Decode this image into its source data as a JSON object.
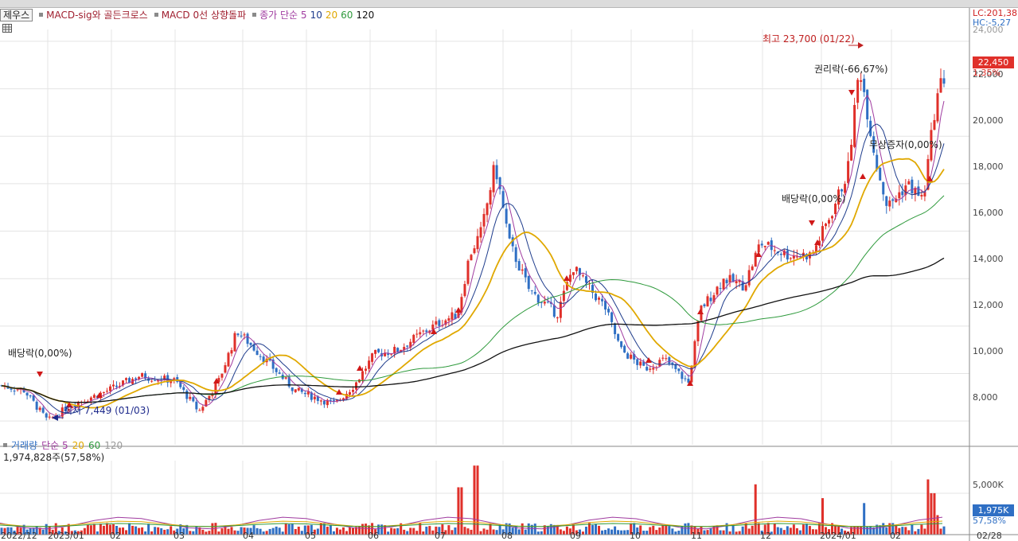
{
  "indicator_legend": {
    "tab_label": "제우스",
    "items": [
      {
        "text": "MACD-sig와 골든크로스"
      },
      {
        "text": "MACD 0선 상향돌파"
      }
    ],
    "ma_prefix": "종가 단순 5",
    "ma_periods": [
      "10",
      "20",
      "60",
      "120"
    ]
  },
  "volume_legend": {
    "title": "거래량",
    "ma_prefix": "단순 5",
    "ma_periods": [
      "20",
      "60",
      "120"
    ],
    "current_volume": "1,974,828주(57,58%)"
  },
  "right_axis": {
    "lc": "LC:201,38",
    "hc": "HC:-5,27",
    "top_cut": "24,000",
    "price_ticks": [
      "22,000",
      "20,000",
      "18,000",
      "16,000",
      "14,000",
      "12,000",
      "10,000",
      "8,000"
    ],
    "current_price": "22,450",
    "current_change": "1,35%",
    "volume_tick": "5,000K",
    "current_volume_tag": "1,975K",
    "current_volume_pct": "57,58%"
  },
  "annotations": {
    "high": "최고 23,700 (01/22)",
    "low": "최저 7,449 (01/03)",
    "dividend_left": "배당락(0,00%)",
    "dividend_right": "배당락(0,00%)",
    "rights_ex": "권리락(-66,67%)",
    "bonus_issue": "무상증자(0,00%)"
  },
  "x_axis": [
    "2022/12",
    "2023/01",
    "02",
    "03",
    "04",
    "05",
    "06",
    "07",
    "08",
    "09",
    "10",
    "11",
    "12",
    "2024/01",
    "02",
    "02/28"
  ],
  "colors": {
    "up": "#e0302a",
    "down": "#2f6fc4",
    "ma5": "#a03ca0",
    "ma10": "#1e3c8c",
    "ma20": "#e0a800",
    "ma60": "#2e9a3c",
    "ma120": "#111111"
  },
  "chart_data": {
    "type": "candlestick",
    "price_range": [
      7000,
      24500
    ],
    "anchors": [
      [
        0,
        9500
      ],
      [
        30,
        9300
      ],
      [
        60,
        8000
      ],
      [
        90,
        8700
      ],
      [
        130,
        9200
      ],
      [
        175,
        9900
      ],
      [
        220,
        9700
      ],
      [
        250,
        8400
      ],
      [
        275,
        9700
      ],
      [
        298,
        11800
      ],
      [
        330,
        10700
      ],
      [
        370,
        9300
      ],
      [
        420,
        8700
      ],
      [
        445,
        9500
      ],
      [
        470,
        10800
      ],
      [
        500,
        11000
      ],
      [
        530,
        11700
      ],
      [
        555,
        12200
      ],
      [
        575,
        12500
      ],
      [
        590,
        15000
      ],
      [
        605,
        16000
      ],
      [
        622,
        18800
      ],
      [
        640,
        15500
      ],
      [
        665,
        13500
      ],
      [
        700,
        12500
      ],
      [
        720,
        14500
      ],
      [
        735,
        13800
      ],
      [
        760,
        12800
      ],
      [
        780,
        11000
      ],
      [
        810,
        10200
      ],
      [
        835,
        10600
      ],
      [
        865,
        9600
      ],
      [
        880,
        12700
      ],
      [
        910,
        14000
      ],
      [
        935,
        13700
      ],
      [
        955,
        15500
      ],
      [
        990,
        15000
      ],
      [
        1020,
        15000
      ],
      [
        1045,
        16800
      ],
      [
        1065,
        18500
      ],
      [
        1080,
        23000
      ],
      [
        1100,
        19000
      ],
      [
        1115,
        17000
      ],
      [
        1140,
        18000
      ],
      [
        1160,
        17300
      ],
      [
        1175,
        21300
      ],
      [
        1184,
        22450
      ]
    ],
    "volume_spikes": [
      [
        598,
        7000
      ],
      [
        578,
        4800
      ],
      [
        948,
        5100
      ],
      [
        1168,
        5600
      ],
      [
        1172,
        4200
      ],
      [
        1032,
        3700
      ],
      [
        1086,
        3200
      ],
      [
        1177,
        1975
      ]
    ]
  }
}
